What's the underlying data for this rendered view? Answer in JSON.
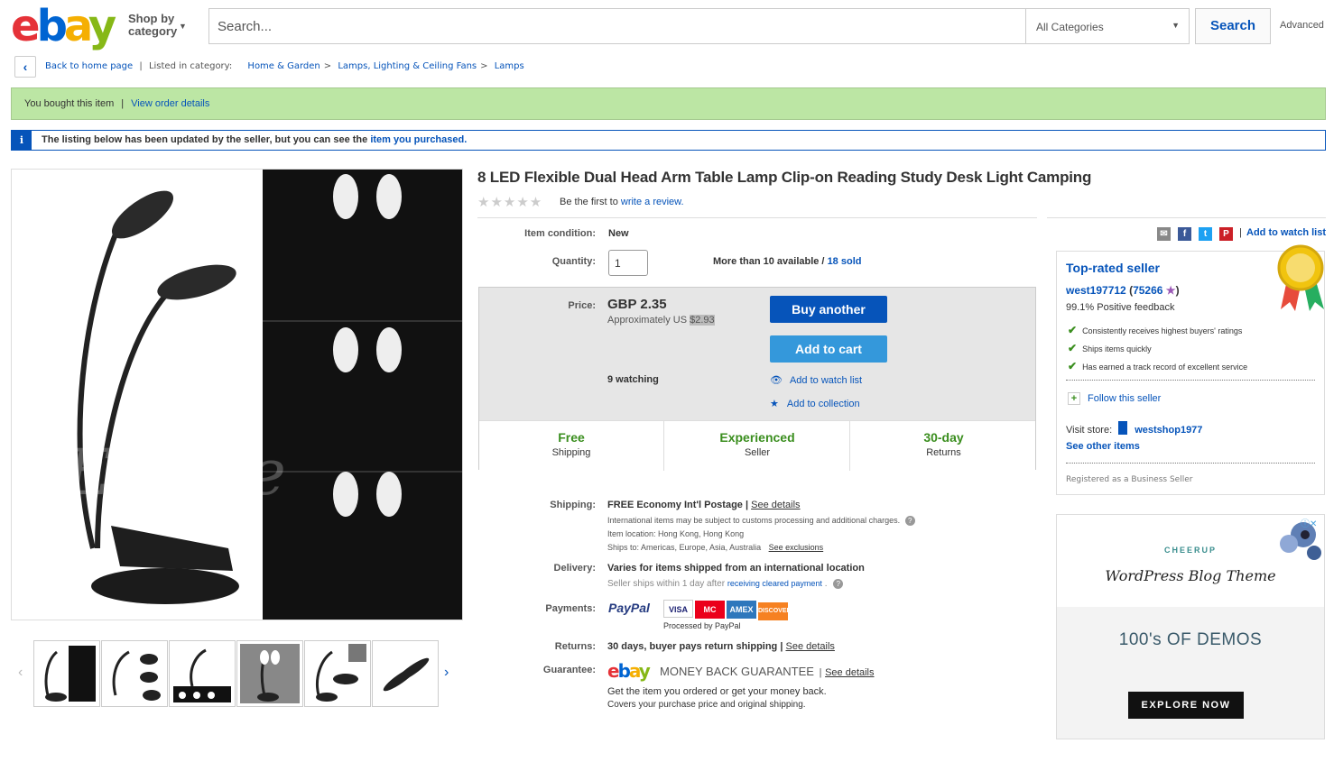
{
  "header": {
    "logo": {
      "e": "e",
      "b": "b",
      "a": "a",
      "y": "y"
    },
    "shop_by_category": "Shop by category",
    "search_placeholder": "Search...",
    "category_select": "All Categories",
    "search_button": "Search",
    "advanced": "Advanced"
  },
  "breadcrumb": {
    "back": "Back to home page",
    "listed_in": "Listed in category:",
    "items": [
      "Home & Garden",
      "Lamps, Lighting & Ceiling Fans",
      "Lamps"
    ]
  },
  "bought_banner": {
    "text": "You bought this item",
    "link": "View order details"
  },
  "notice": {
    "text": "The listing below has been updated by the seller, but you can see the",
    "link": "item you purchased."
  },
  "listing": {
    "title": "8 LED Flexible Dual Head Arm Table Lamp Clip-on Reading Study Desk Light Camping",
    "rating_stars": 0,
    "review_prefix": "Be the first to",
    "review_link": "write a review.",
    "condition_label": "Item condition:",
    "condition_value": "New",
    "quantity_label": "Quantity:",
    "quantity_value": "1",
    "availability": "More than 10 available /",
    "sold": "18 sold",
    "price_label": "Price:",
    "price": "GBP 2.35",
    "approx_prefix": "Approximately US",
    "approx_value": "$2.93",
    "watching": "9 watching",
    "buy_another": "Buy another",
    "add_to_cart": "Add to cart",
    "add_watch": "Add to watch list",
    "add_collection": "Add to collection",
    "features": [
      {
        "big": "Free",
        "small": "Shipping"
      },
      {
        "big": "Experienced",
        "small": "Seller"
      },
      {
        "big": "30-day",
        "small": "Returns"
      }
    ]
  },
  "share": {
    "watch_link": "Add to watch list"
  },
  "details": {
    "shipping_label": "Shipping:",
    "shipping_value": "FREE  Economy Int'l Postage",
    "see_details": "See details",
    "customs_note": "International items may be subject to customs processing and additional charges.",
    "item_location": "Item location:  Hong Kong, Hong Kong",
    "ships_to": "Ships to:  Americas, Europe, Asia, Australia",
    "see_exclusions": "See exclusions",
    "delivery_label": "Delivery:",
    "delivery_value": "Varies for items shipped from an international location",
    "seller_ships": "Seller ships within 1 day after",
    "receiving_payment": "receiving cleared payment",
    "payments_label": "Payments:",
    "paypal": "PayPal",
    "processed_by": "Processed by PayPal",
    "cards": [
      "VISA",
      "MC",
      "AMEX",
      "DISCOVER"
    ],
    "returns_label": "Returns:",
    "returns_value": "30 days, buyer pays return shipping",
    "guarantee_label": "Guarantee:",
    "guarantee_text": "MONEY BACK GUARANTEE",
    "guarantee_line1": "Get the item you ordered or get your money back.",
    "guarantee_line2": "Covers your purchase price and original shipping."
  },
  "seller_box": {
    "title": "Top-rated seller",
    "name": "west197712",
    "score": "75266",
    "feedback": "99.1% Positive feedback",
    "points": [
      "Consistently receives highest buyers' ratings",
      "Ships items quickly",
      "Has earned a track record of excellent service"
    ],
    "follow": "Follow this seller",
    "visit_label": "Visit store:",
    "store": "westshop1977",
    "see_other": "See other items",
    "registered": "Registered as a Business Seller"
  },
  "ad": {
    "brand": "CHEERUP",
    "headline": "WordPress Blog Theme",
    "sub": "100's OF DEMOS",
    "cta": "EXPLORE NOW"
  },
  "colors": {
    "ebay_blue": "#0654ba",
    "green_banner": "#bce6a4",
    "feature_green": "#3a8e1e"
  }
}
